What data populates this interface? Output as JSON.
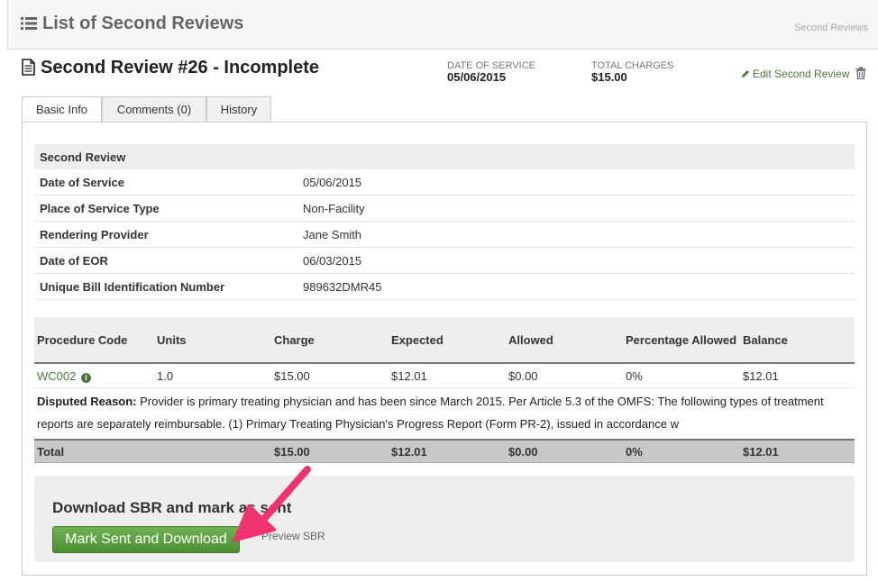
{
  "header": {
    "title": "List of Second Reviews",
    "breadcrumb": "Second Reviews"
  },
  "review": {
    "title": "Second Review #26 - Incomplete",
    "date_of_service_label": "DATE OF SERVICE",
    "date_of_service": "05/06/2015",
    "total_charges_label": "TOTAL CHARGES",
    "total_charges": "$15.00",
    "edit_label": "Edit Second Review"
  },
  "tabs": [
    {
      "label": "Basic Info",
      "active": true
    },
    {
      "label": "Comments (0)",
      "active": false
    },
    {
      "label": "History",
      "active": false
    }
  ],
  "info": {
    "section": "Second Review",
    "rows": [
      {
        "label": "Date of Service",
        "value": "05/06/2015"
      },
      {
        "label": "Place of Service Type",
        "value": "Non-Facility"
      },
      {
        "label": "Rendering Provider",
        "value": "Jane Smith"
      },
      {
        "label": "Date of EOR",
        "value": "06/03/2015"
      },
      {
        "label": "Unique Bill Identification Number",
        "value": "989632DMR45"
      }
    ]
  },
  "procedures": {
    "headers": [
      "Procedure Code",
      "Units",
      "Charge",
      "Expected",
      "Allowed",
      "Percentage Allowed",
      "Balance"
    ],
    "row": {
      "code": "WC002",
      "units": "1.0",
      "charge": "$15.00",
      "expected": "$12.01",
      "allowed": "$0.00",
      "percentage": "0%",
      "balance": "$12.01"
    },
    "disputed_label": "Disputed Reason:",
    "disputed_text": " Provider is primary treating physician and has been since March 2015. Per Article 5.3 of the OMFS: The following types of treatment reports are separately reimbursable. (1) Primary Treating Physician's Progress Report (Form PR-2), issued in accordance w",
    "total": {
      "label": "Total",
      "charge": "$15.00",
      "expected": "$12.01",
      "allowed": "$0.00",
      "percentage": "0%",
      "balance": "$12.01"
    }
  },
  "download": {
    "heading": "Download SBR and mark as sent",
    "button": "Mark Sent and Download",
    "preview": "Preview SBR"
  },
  "colors": {
    "accent_green": "#4b8f31",
    "link_green": "#4a7a3a",
    "annotation_arrow": "#f0336e"
  }
}
